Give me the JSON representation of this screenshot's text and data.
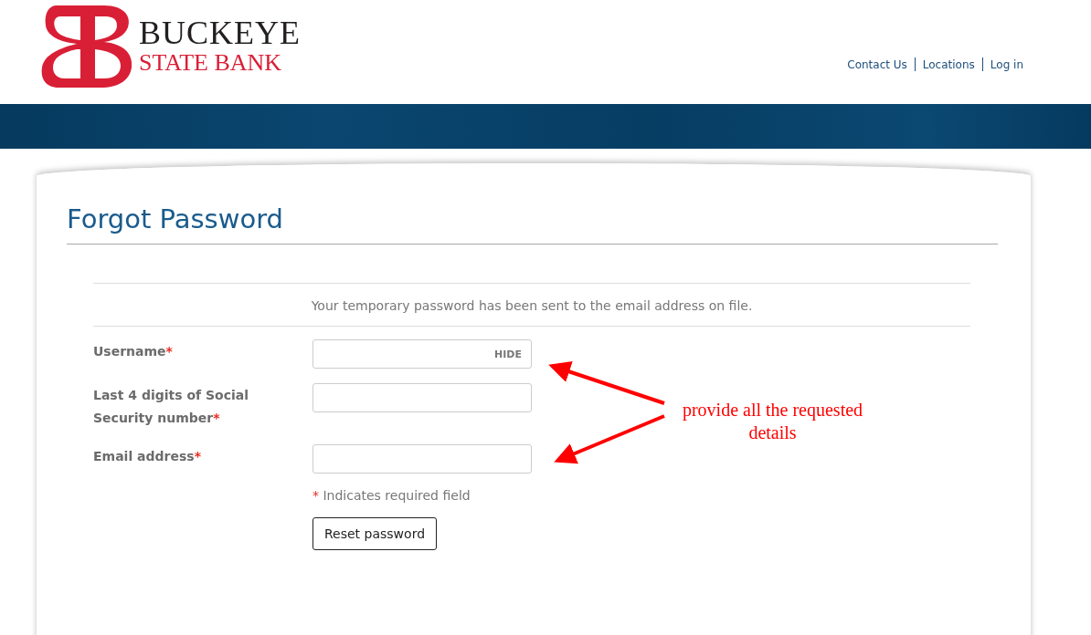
{
  "logo": {
    "line_1": "BUCKEYE",
    "line_2": "STATE BANK"
  },
  "nav": [
    {
      "label": "Contact Us"
    },
    {
      "label": "Locations"
    },
    {
      "label": "Log in"
    }
  ],
  "page_title": "Forgot Password",
  "message": "Your temporary password has been sent to the email address on file.",
  "fields": [
    {
      "label": "Username",
      "required_mark": "*",
      "toggle": "HIDE"
    },
    {
      "label": "Last 4 digits of Social Security number",
      "required_mark": "*"
    },
    {
      "label": "Email address",
      "required_mark": "*"
    }
  ],
  "required_note": {
    "mark": "*",
    "text": "Indicates required field"
  },
  "submit": "Reset password",
  "annotation": {
    "text": "provide all the requested details"
  }
}
